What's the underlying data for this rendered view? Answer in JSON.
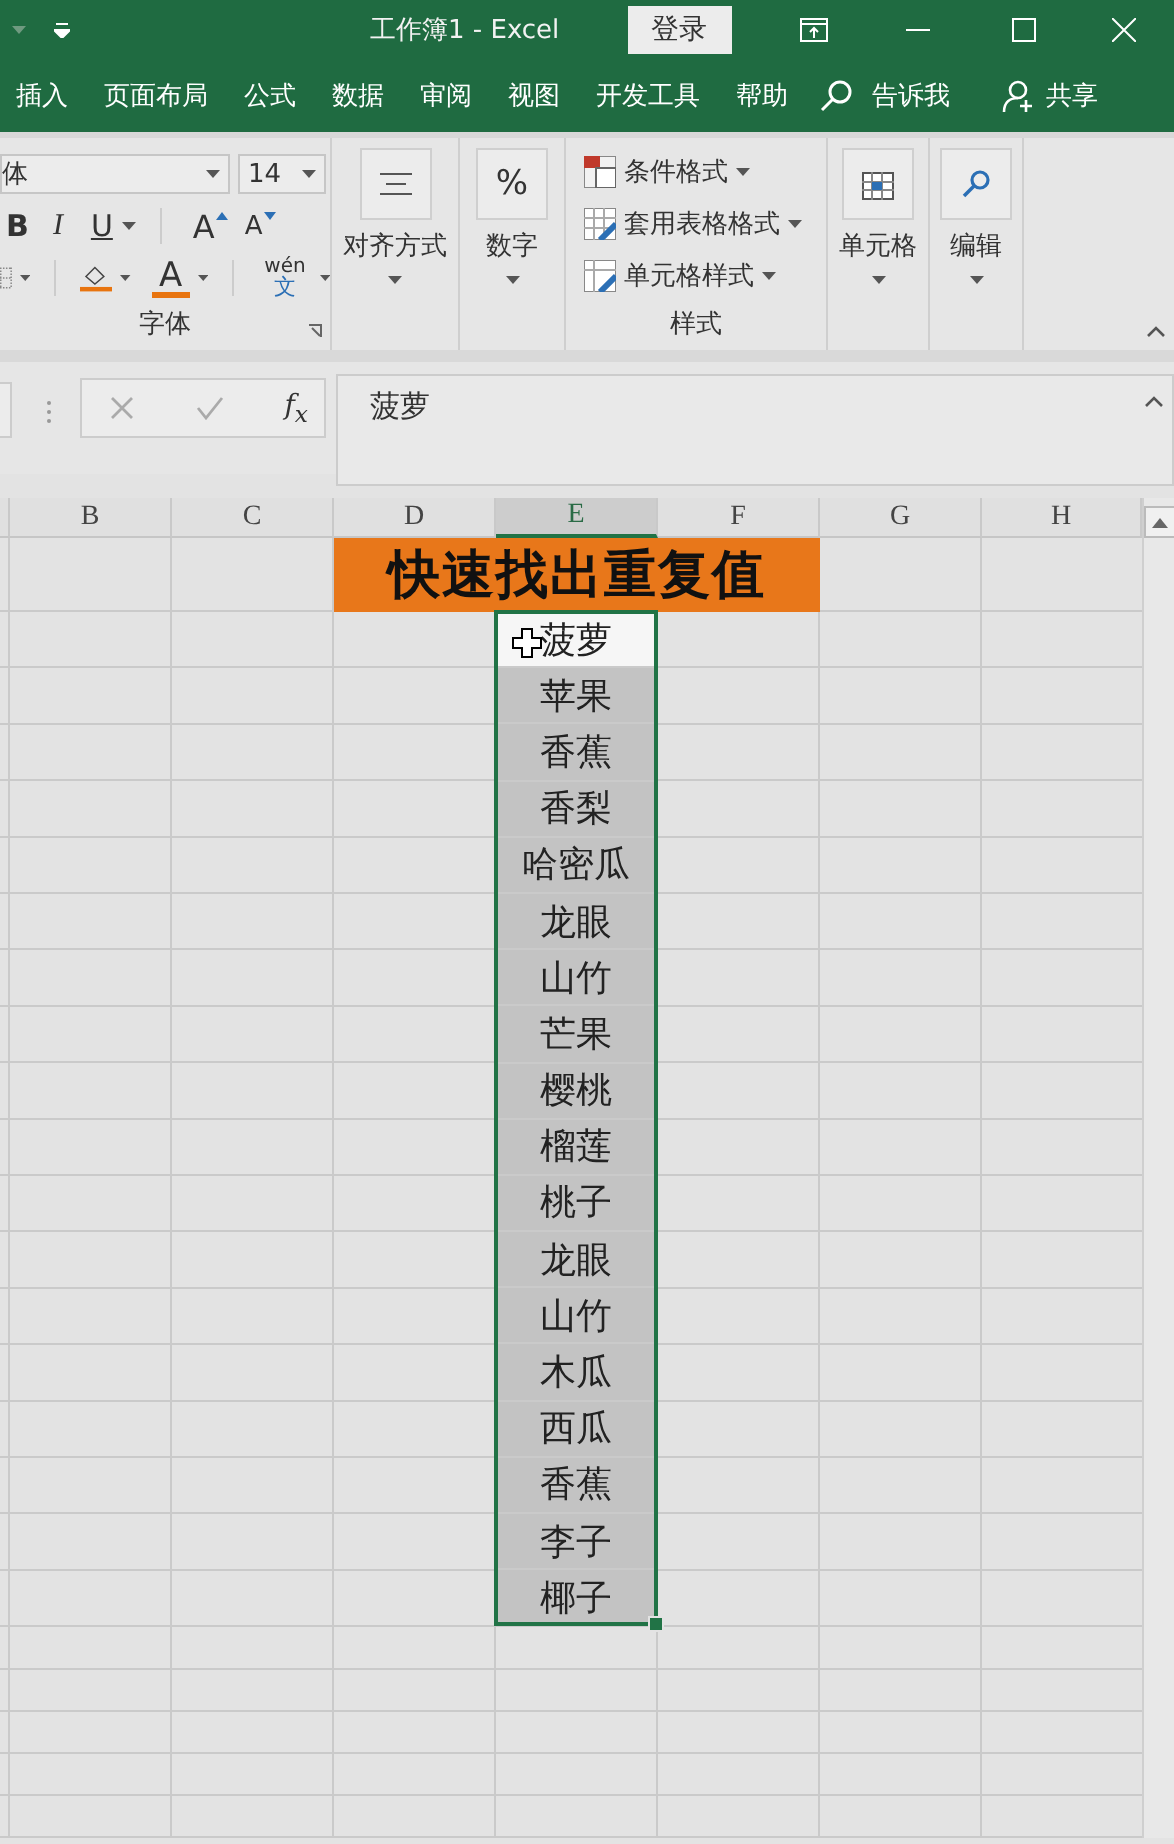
{
  "title_bar": {
    "title": "工作簿1 - Excel",
    "sign_in": "登录"
  },
  "tabs": [
    {
      "label": "插入",
      "selected": false
    },
    {
      "label": "页面布局",
      "selected": false
    },
    {
      "label": "公式",
      "selected": false
    },
    {
      "label": "数据",
      "selected": false
    },
    {
      "label": "审阅",
      "selected": false
    },
    {
      "label": "视图",
      "selected": false
    },
    {
      "label": "开发工具",
      "selected": false
    },
    {
      "label": "帮助",
      "selected": false
    }
  ],
  "tell_me": "告诉我",
  "share": "共享",
  "ribbon": {
    "font": {
      "font_name": "体",
      "font_size": "14",
      "bold": "B",
      "italic": "I",
      "underline": "U",
      "grow_font": "A",
      "shrink_font": "A",
      "font_color": "A",
      "phonetic": "wén",
      "phonetic_char": "文",
      "label": "字体"
    },
    "alignment": {
      "label": "对齐方式"
    },
    "number": {
      "symbol": "%",
      "label": "数字"
    },
    "styles": {
      "items": [
        "条件格式",
        "套用表格格式",
        "单元格样式"
      ],
      "label": "样式"
    },
    "cells": {
      "label": "单元格"
    },
    "editing": {
      "label": "编辑"
    }
  },
  "formula_bar": {
    "function_label": "f$_{x}$",
    "value": "菠萝"
  },
  "sheet": {
    "columns": [
      {
        "label": "B",
        "selected": false
      },
      {
        "label": "C",
        "selected": false
      },
      {
        "label": "D",
        "selected": false
      },
      {
        "label": "E",
        "selected": true
      },
      {
        "label": "F",
        "selected": false
      },
      {
        "label": "G",
        "selected": false
      },
      {
        "label": "H",
        "selected": false
      }
    ],
    "title": "快速找出重复值",
    "cells": [
      {
        "text": "菠萝",
        "selected": true,
        "active": true
      },
      {
        "text": "苹果",
        "selected": true,
        "active": false
      },
      {
        "text": "香蕉",
        "selected": true,
        "active": false
      },
      {
        "text": "香梨",
        "selected": true,
        "active": false
      },
      {
        "text": "哈密瓜",
        "selected": true,
        "active": false
      },
      {
        "text": "龙眼",
        "selected": true,
        "active": false
      },
      {
        "text": "山竹",
        "selected": true,
        "active": false
      },
      {
        "text": "芒果",
        "selected": true,
        "active": false
      },
      {
        "text": "樱桃",
        "selected": true,
        "active": false
      },
      {
        "text": "榴莲",
        "selected": true,
        "active": false
      },
      {
        "text": "桃子",
        "selected": true,
        "active": false
      },
      {
        "text": "龙眼",
        "selected": true,
        "active": false
      },
      {
        "text": "山竹",
        "selected": true,
        "active": false
      },
      {
        "text": "木瓜",
        "selected": true,
        "active": false
      },
      {
        "text": "西瓜",
        "selected": true,
        "active": false
      },
      {
        "text": "香蕉",
        "selected": true,
        "active": false
      },
      {
        "text": "李子",
        "selected": true,
        "active": false
      },
      {
        "text": "椰子",
        "selected": true,
        "active": false
      }
    ]
  }
}
